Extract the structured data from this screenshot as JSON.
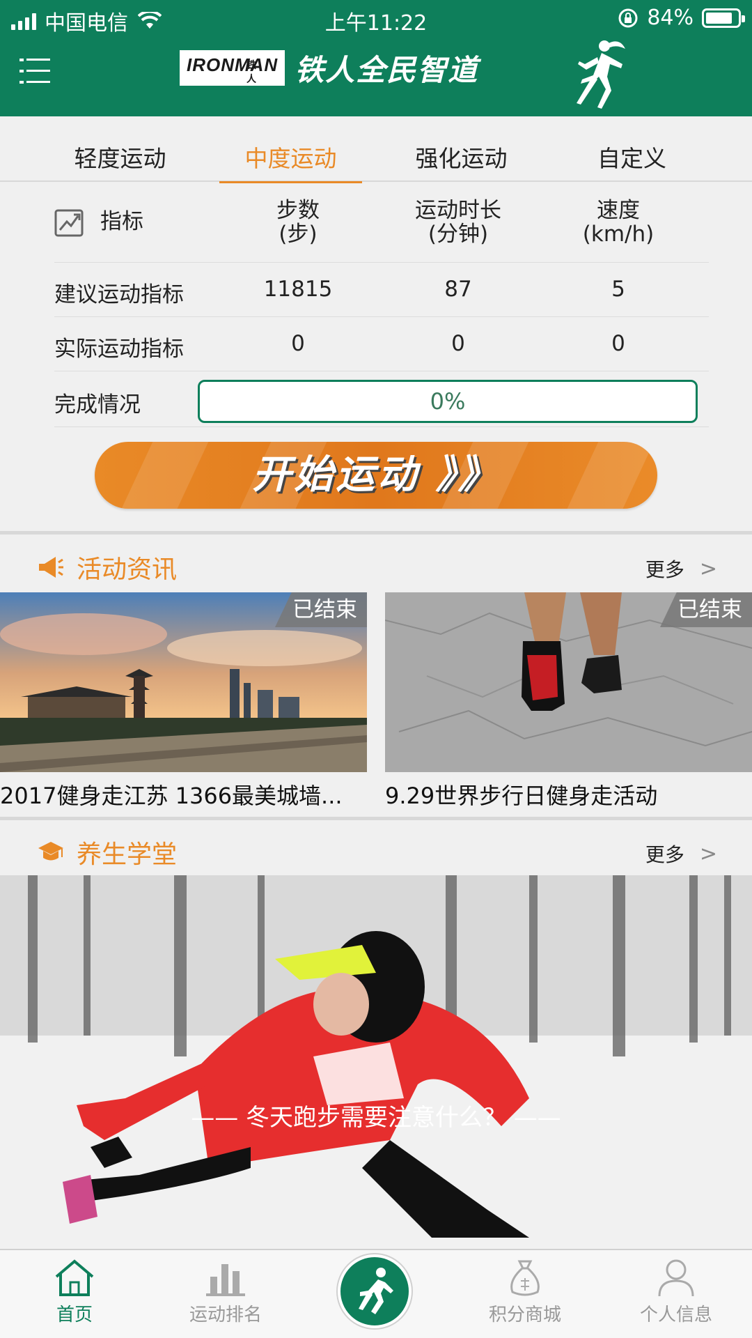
{
  "status_bar": {
    "carrier": "中国电信",
    "time": "上午11:22",
    "battery": "84%",
    "battery_level": 0.84
  },
  "header": {
    "brand_en": "IRONMAN",
    "brand_sub": "铁人",
    "brand_cn": "铁人全民智道",
    "menu_icon": "hamburger-icon",
    "mascot": "runner-silhouette"
  },
  "tabs": [
    {
      "label": "轻度运动",
      "active": false
    },
    {
      "label": "中度运动",
      "active": true
    },
    {
      "label": "强化运动",
      "active": false
    },
    {
      "label": "自定义",
      "active": false
    }
  ],
  "stats": {
    "header": {
      "metric": "指标",
      "steps": "步数",
      "steps_unit": "(步)",
      "duration": "运动时长",
      "duration_unit": "(分钟)",
      "speed": "速度",
      "speed_unit": "(km/h)"
    },
    "suggested": {
      "label": "建议运动指标",
      "steps": "11815",
      "duration": "87",
      "speed": "5"
    },
    "actual": {
      "label": "实际运动指标",
      "steps": "0",
      "duration": "0",
      "speed": "0"
    },
    "completion": {
      "label": "完成情况",
      "value": "0%",
      "progress": 0
    }
  },
  "start_button": {
    "label": "开始运动 》》"
  },
  "activities": {
    "title": "活动资讯",
    "more": "更多",
    "items": [
      {
        "caption": "2017健身走江苏 1366最美城墙...",
        "badge": "已结束"
      },
      {
        "caption": "9.29世界步行日健身走活动",
        "badge": "已结束"
      }
    ]
  },
  "school": {
    "title": "养生学堂",
    "more": "更多",
    "feature_caption": "—— 冬天跑步需要注意什么？ ——"
  },
  "bottom_nav": [
    {
      "label": "首页",
      "icon": "home-icon",
      "active": true
    },
    {
      "label": "运动排名",
      "icon": "bar-chart-icon",
      "active": false
    },
    {
      "label": "",
      "icon": "runner-icon",
      "active": false
    },
    {
      "label": "积分商城",
      "icon": "money-bag-icon",
      "active": false
    },
    {
      "label": "个人信息",
      "icon": "person-icon",
      "active": false
    }
  ],
  "colors": {
    "primary": "#0e7f5b",
    "accent": "#e98a27",
    "background": "#f0f0f0"
  }
}
